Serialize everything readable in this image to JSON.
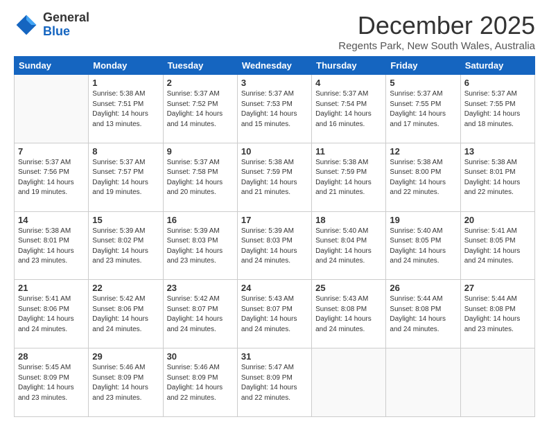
{
  "logo": {
    "general": "General",
    "blue": "Blue"
  },
  "header": {
    "month": "December 2025",
    "location": "Regents Park, New South Wales, Australia"
  },
  "weekdays": [
    "Sunday",
    "Monday",
    "Tuesday",
    "Wednesday",
    "Thursday",
    "Friday",
    "Saturday"
  ],
  "weeks": [
    [
      {
        "day": "",
        "info": ""
      },
      {
        "day": "1",
        "info": "Sunrise: 5:38 AM\nSunset: 7:51 PM\nDaylight: 14 hours\nand 13 minutes."
      },
      {
        "day": "2",
        "info": "Sunrise: 5:37 AM\nSunset: 7:52 PM\nDaylight: 14 hours\nand 14 minutes."
      },
      {
        "day": "3",
        "info": "Sunrise: 5:37 AM\nSunset: 7:53 PM\nDaylight: 14 hours\nand 15 minutes."
      },
      {
        "day": "4",
        "info": "Sunrise: 5:37 AM\nSunset: 7:54 PM\nDaylight: 14 hours\nand 16 minutes."
      },
      {
        "day": "5",
        "info": "Sunrise: 5:37 AM\nSunset: 7:55 PM\nDaylight: 14 hours\nand 17 minutes."
      },
      {
        "day": "6",
        "info": "Sunrise: 5:37 AM\nSunset: 7:55 PM\nDaylight: 14 hours\nand 18 minutes."
      }
    ],
    [
      {
        "day": "7",
        "info": "Sunrise: 5:37 AM\nSunset: 7:56 PM\nDaylight: 14 hours\nand 19 minutes."
      },
      {
        "day": "8",
        "info": "Sunrise: 5:37 AM\nSunset: 7:57 PM\nDaylight: 14 hours\nand 19 minutes."
      },
      {
        "day": "9",
        "info": "Sunrise: 5:37 AM\nSunset: 7:58 PM\nDaylight: 14 hours\nand 20 minutes."
      },
      {
        "day": "10",
        "info": "Sunrise: 5:38 AM\nSunset: 7:59 PM\nDaylight: 14 hours\nand 21 minutes."
      },
      {
        "day": "11",
        "info": "Sunrise: 5:38 AM\nSunset: 7:59 PM\nDaylight: 14 hours\nand 21 minutes."
      },
      {
        "day": "12",
        "info": "Sunrise: 5:38 AM\nSunset: 8:00 PM\nDaylight: 14 hours\nand 22 minutes."
      },
      {
        "day": "13",
        "info": "Sunrise: 5:38 AM\nSunset: 8:01 PM\nDaylight: 14 hours\nand 22 minutes."
      }
    ],
    [
      {
        "day": "14",
        "info": "Sunrise: 5:38 AM\nSunset: 8:01 PM\nDaylight: 14 hours\nand 23 minutes."
      },
      {
        "day": "15",
        "info": "Sunrise: 5:39 AM\nSunset: 8:02 PM\nDaylight: 14 hours\nand 23 minutes."
      },
      {
        "day": "16",
        "info": "Sunrise: 5:39 AM\nSunset: 8:03 PM\nDaylight: 14 hours\nand 23 minutes."
      },
      {
        "day": "17",
        "info": "Sunrise: 5:39 AM\nSunset: 8:03 PM\nDaylight: 14 hours\nand 24 minutes."
      },
      {
        "day": "18",
        "info": "Sunrise: 5:40 AM\nSunset: 8:04 PM\nDaylight: 14 hours\nand 24 minutes."
      },
      {
        "day": "19",
        "info": "Sunrise: 5:40 AM\nSunset: 8:05 PM\nDaylight: 14 hours\nand 24 minutes."
      },
      {
        "day": "20",
        "info": "Sunrise: 5:41 AM\nSunset: 8:05 PM\nDaylight: 14 hours\nand 24 minutes."
      }
    ],
    [
      {
        "day": "21",
        "info": "Sunrise: 5:41 AM\nSunset: 8:06 PM\nDaylight: 14 hours\nand 24 minutes."
      },
      {
        "day": "22",
        "info": "Sunrise: 5:42 AM\nSunset: 8:06 PM\nDaylight: 14 hours\nand 24 minutes."
      },
      {
        "day": "23",
        "info": "Sunrise: 5:42 AM\nSunset: 8:07 PM\nDaylight: 14 hours\nand 24 minutes."
      },
      {
        "day": "24",
        "info": "Sunrise: 5:43 AM\nSunset: 8:07 PM\nDaylight: 14 hours\nand 24 minutes."
      },
      {
        "day": "25",
        "info": "Sunrise: 5:43 AM\nSunset: 8:08 PM\nDaylight: 14 hours\nand 24 minutes."
      },
      {
        "day": "26",
        "info": "Sunrise: 5:44 AM\nSunset: 8:08 PM\nDaylight: 14 hours\nand 24 minutes."
      },
      {
        "day": "27",
        "info": "Sunrise: 5:44 AM\nSunset: 8:08 PM\nDaylight: 14 hours\nand 23 minutes."
      }
    ],
    [
      {
        "day": "28",
        "info": "Sunrise: 5:45 AM\nSunset: 8:09 PM\nDaylight: 14 hours\nand 23 minutes."
      },
      {
        "day": "29",
        "info": "Sunrise: 5:46 AM\nSunset: 8:09 PM\nDaylight: 14 hours\nand 23 minutes."
      },
      {
        "day": "30",
        "info": "Sunrise: 5:46 AM\nSunset: 8:09 PM\nDaylight: 14 hours\nand 22 minutes."
      },
      {
        "day": "31",
        "info": "Sunrise: 5:47 AM\nSunset: 8:09 PM\nDaylight: 14 hours\nand 22 minutes."
      },
      {
        "day": "",
        "info": ""
      },
      {
        "day": "",
        "info": ""
      },
      {
        "day": "",
        "info": ""
      }
    ]
  ]
}
